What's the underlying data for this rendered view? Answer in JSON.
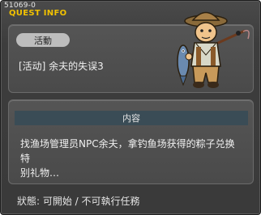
{
  "window": {
    "quest_id": "51069-0",
    "title": "QUEST INFO"
  },
  "quest": {
    "category_badge": "活動",
    "name": "[活动] 余夫的失误3"
  },
  "details": {
    "header": "内容",
    "description_lines": [
      "找渔场管理员NPC余夫，拿钓鱼场获得的粽子兑换特",
      "别礼物…"
    ]
  },
  "status": {
    "text": "狀態: 可開始 / 不可執行任務"
  }
}
